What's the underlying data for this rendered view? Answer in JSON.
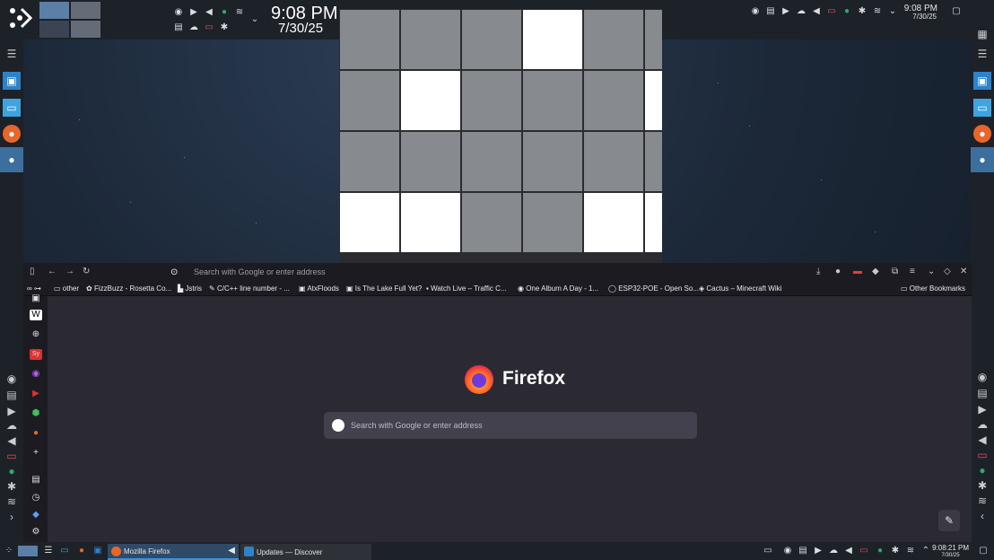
{
  "top_panel": {
    "time": "9:08 PM",
    "date": "7/30/25",
    "right_time": "9:08 PM",
    "right_date": "7/30/25"
  },
  "game": {
    "grid": [
      [
        0,
        0,
        0,
        1,
        0,
        0
      ],
      [
        0,
        1,
        0,
        0,
        0,
        1
      ],
      [
        0,
        0,
        0,
        0,
        0,
        0
      ],
      [
        1,
        1,
        0,
        0,
        1,
        1
      ]
    ]
  },
  "firefox": {
    "toolbar_url_placeholder": "Search with Google or enter address",
    "bookmarks": [
      {
        "label": "other",
        "icon": "folder-icon"
      },
      {
        "label": "FizzBuzz - Rosetta Co...",
        "icon": "fizzbuzz-icon"
      },
      {
        "label": "Jstris",
        "icon": "jstris-icon"
      },
      {
        "label": "C/C++ line number - ...",
        "icon": "code-icon"
      },
      {
        "label": "AtxFloods",
        "icon": "atx-icon"
      },
      {
        "label": "Is The Lake Full Yet?",
        "icon": "lake-icon"
      },
      {
        "label": "Watch Live – Traffic C...",
        "icon": "traffic-icon"
      },
      {
        "label": "One Album A Day - 1...",
        "icon": "album-icon"
      },
      {
        "label": "ESP32-POE - Open So...",
        "icon": "olimex-icon"
      },
      {
        "label": "Cactus – Minecraft Wiki",
        "icon": "minecraft-icon"
      }
    ],
    "other_bookmarks": "Other Bookmarks",
    "title": "Firefox",
    "search_placeholder": "Search with Google or enter address"
  },
  "taskbar": {
    "tasks": [
      {
        "label": "Mozilla Firefox",
        "active": true
      },
      {
        "label": "Updates — Discover",
        "active": false
      }
    ],
    "clock_time": "9:08:21 PM",
    "clock_date": "7/30/25"
  }
}
